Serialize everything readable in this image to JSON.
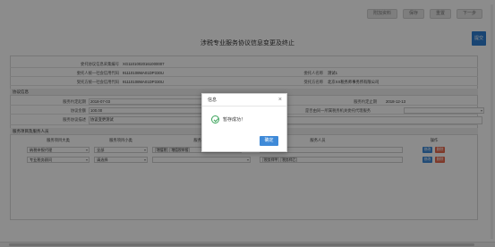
{
  "toolbar": {
    "btn1": "附加资料",
    "btn2": "保存",
    "btn3": "重置",
    "btn4": "下一步"
  },
  "side_button": "提交",
  "page_title": "涉税专业服务协议信息变更及终止",
  "form": {
    "row1": {
      "label": "委托协议信息采集编号",
      "value": "XG11010020161000007"
    },
    "row2": {
      "label": "委托人统一社会信用代码",
      "value": "91110108MA01DP330U",
      "right_label": "委托人名称",
      "right_value": "测试1"
    },
    "row3": {
      "label": "受托方统一社会信用代码",
      "value": "91110108MA01DP330U",
      "right_label": "受托方名称",
      "right_value": "北京XX税务师事务所有限公司"
    }
  },
  "section_protocol": {
    "title": "协议信息",
    "start_label": "服务约定起期",
    "start_value": "2018-07-03",
    "end_label": "服务约定止期",
    "end_value": "2018-12-13",
    "amount_label": "协议金额",
    "amount_value": "100.00",
    "confirm_label": "是否由同一所属税务机关委托代理服务",
    "desc_label": "服务协议描述",
    "desc_value": "协议变更测试"
  },
  "section_staff": {
    "title": "服务项目及服务人员",
    "headers": {
      "category": "服务项目大类",
      "sub": "服务项目小类",
      "content": "服务内容",
      "person": "服务人员",
      "op": "操作"
    },
    "rows": [
      {
        "category": "纳税申报代理",
        "sub": "全部",
        "content_tags": [
          "增值税",
          "增值税申报"
        ],
        "person_tags": [],
        "op1": "修改",
        "op2": "删除"
      },
      {
        "category": "专业税务顾问",
        "sub": "请选择",
        "content_tags": [],
        "person_tags": [
          "税务师甲",
          "税务师乙"
        ],
        "op1": "修改",
        "op2": "删除"
      }
    ]
  },
  "dialog": {
    "title": "信息",
    "message": "暂存成功！",
    "ok_label": "确定"
  },
  "colors": {
    "accent": "#3f8ad8",
    "danger": "#e86a4f",
    "success": "#3aa35a"
  }
}
